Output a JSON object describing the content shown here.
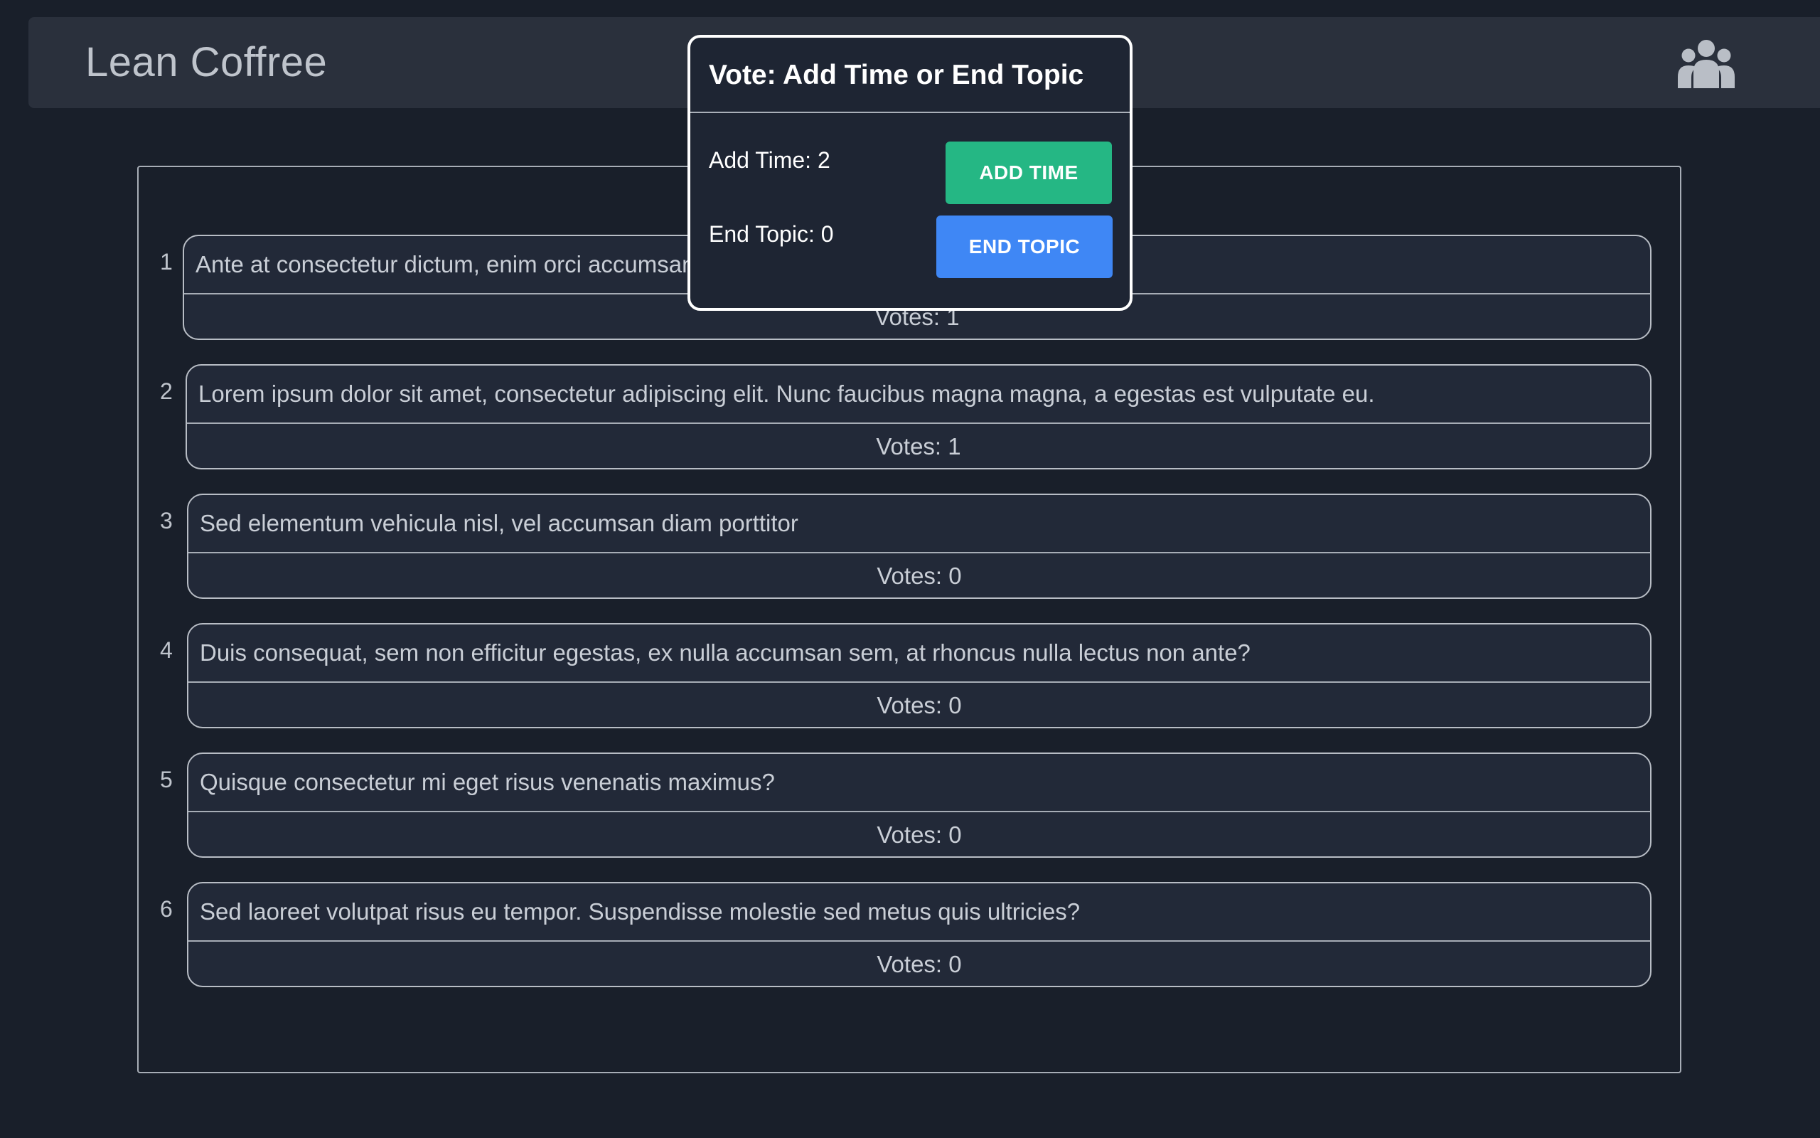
{
  "app": {
    "title": "Lean Coffree"
  },
  "header": {
    "users_icon": "users-icon"
  },
  "topics": [
    {
      "index": "1",
      "text": "Ante at consectetur dictum, enim orci accumsan",
      "votes": "Votes: 1"
    },
    {
      "index": "2",
      "text": "Lorem ipsum dolor sit amet, consectetur adipiscing elit. Nunc faucibus magna magna, a egestas est vulputate eu.",
      "votes": "Votes: 1"
    },
    {
      "index": "3",
      "text": "Sed elementum vehicula nisl, vel accumsan diam porttitor",
      "votes": "Votes: 0"
    },
    {
      "index": "4",
      "text": "Duis consequat, sem non efficitur egestas, ex nulla accumsan sem, at rhoncus nulla lectus non ante?",
      "votes": "Votes: 0"
    },
    {
      "index": "5",
      "text": "Quisque consectetur mi eget risus venenatis maximus?",
      "votes": "Votes: 0"
    },
    {
      "index": "6",
      "text": "Sed laoreet volutpat risus eu tempor. Suspendisse molestie sed metus quis ultricies?",
      "votes": "Votes: 0"
    }
  ],
  "modal": {
    "title": "Vote: Add Time or End Topic",
    "add_time_count": "Add Time: 2",
    "end_topic_count": "End Topic: 0",
    "add_time_button": "ADD TIME",
    "end_topic_button": "END TOPIC"
  },
  "colors": {
    "background": "#191f2a",
    "navbar": "#2a303c",
    "card": "#222938",
    "add_time": "#25b784",
    "end_topic": "#3f87f5"
  }
}
